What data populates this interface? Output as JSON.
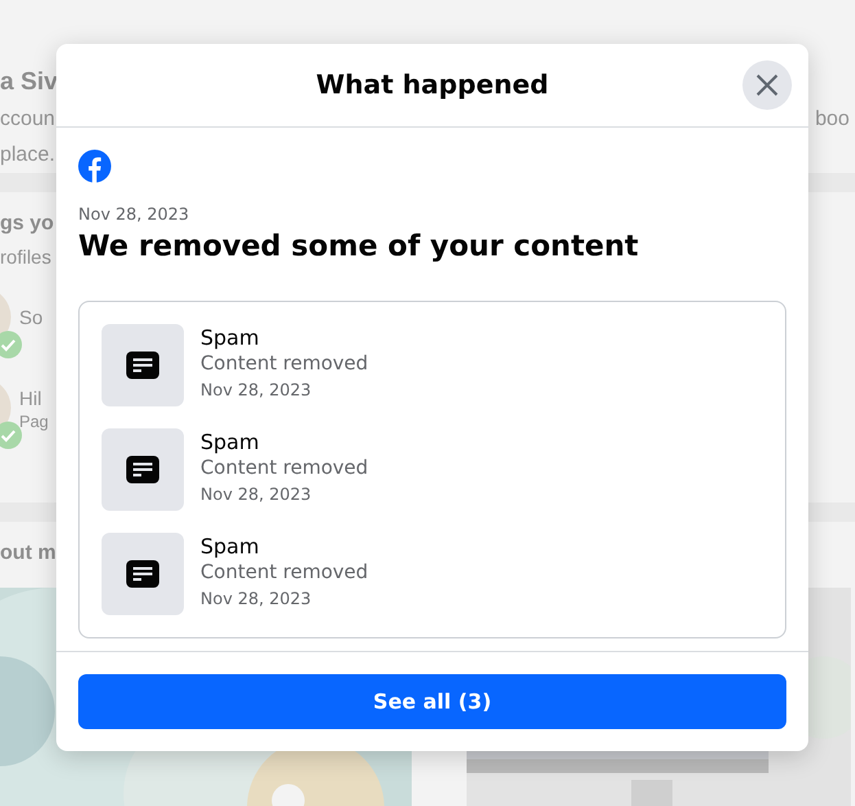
{
  "background": {
    "profile_card": {
      "name": "a Siv",
      "line_1": "ccoun",
      "line_1_end": "boo",
      "line_2": "place."
    },
    "people_card": {
      "title": "gs yo",
      "subtitle": "rofiles",
      "people": [
        {
          "name": "So",
          "verified": true
        },
        {
          "name": "Hil",
          "subtitle": "Pag",
          "verified": true
        }
      ]
    },
    "about_card": {
      "title": "out m"
    }
  },
  "dialog": {
    "title": "What happened",
    "date": "Nov 28, 2023",
    "heading": "We removed some of your content",
    "items": [
      {
        "title": "Spam",
        "status": "Content removed",
        "date": "Nov 28, 2023"
      },
      {
        "title": "Spam",
        "status": "Content removed",
        "date": "Nov 28, 2023"
      },
      {
        "title": "Spam",
        "status": "Content removed",
        "date": "Nov 28, 2023"
      }
    ],
    "button": "See all (3)"
  }
}
